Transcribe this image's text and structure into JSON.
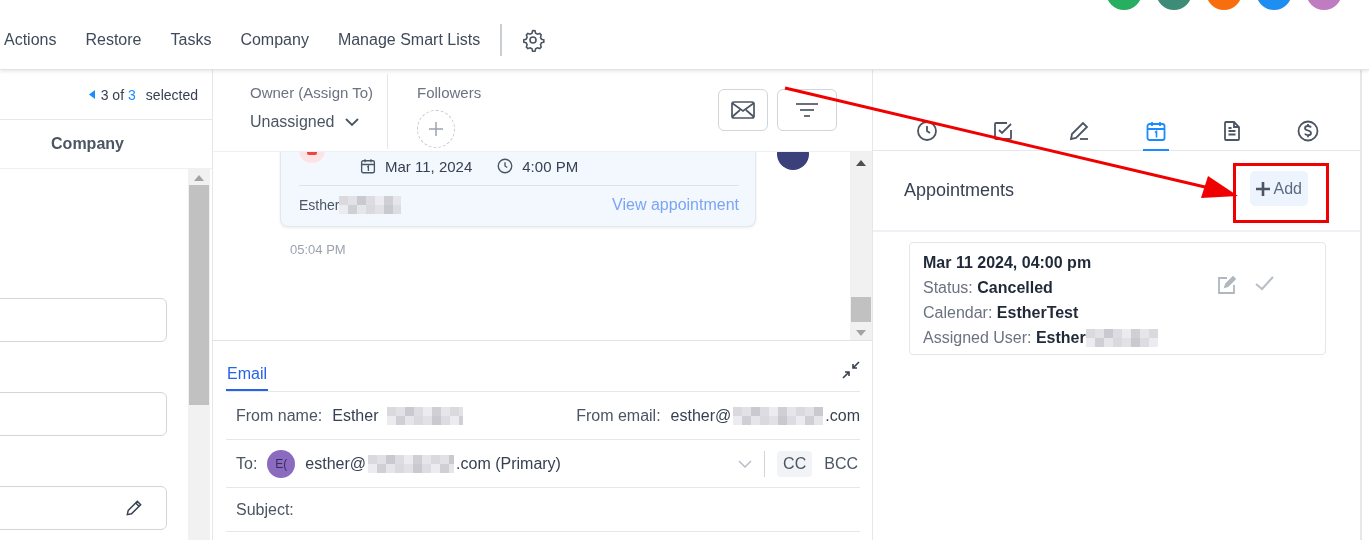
{
  "nav": {
    "items": [
      "Actions",
      "Restore",
      "Tasks",
      "Company",
      "Manage Smart Lists"
    ]
  },
  "avatars": [
    {
      "color": "#27ae60"
    },
    {
      "color": "#3d8c78"
    },
    {
      "color": "#f86d0d"
    },
    {
      "color": "#1f8ef1"
    },
    {
      "color": "#c07cc0"
    }
  ],
  "selection": {
    "prefix": "3 of",
    "count": "3",
    "suffix": "selected"
  },
  "contact_list": {
    "column": "Company",
    "fields": [
      {
        "kind": "text"
      },
      {
        "kind": "text"
      },
      {
        "kind": "editable"
      }
    ]
  },
  "owner": {
    "label": "Owner (Assign To)",
    "value": "Unassigned"
  },
  "followers": {
    "label": "Followers"
  },
  "appointment_message": {
    "date": "Mar 11, 2024",
    "time": "4:00 PM",
    "author": "Esther",
    "link": "View appointment",
    "timestamp": "05:04 PM"
  },
  "compose": {
    "tabs": [
      {
        "label": "Email",
        "selected": true
      }
    ],
    "from_name_label": "From name:",
    "from_name": "Esther",
    "from_email_label": "From email:",
    "from_email_user": "esther@",
    "from_email_domain": ".com",
    "to_label": "To:",
    "to_avatar": "E(",
    "to_user": "esther@",
    "to_domain": ".com (Primary)",
    "cc": "CC",
    "bcc": "BCC",
    "subject_label": "Subject:"
  },
  "side_tabs": [
    {
      "kind": "history",
      "selected": false
    },
    {
      "kind": "task",
      "selected": false
    },
    {
      "kind": "note",
      "selected": false
    },
    {
      "kind": "calendar",
      "selected": true
    },
    {
      "kind": "document",
      "selected": false
    },
    {
      "kind": "payment",
      "selected": false
    }
  ],
  "appointments": {
    "title": "Appointments",
    "add": "Add",
    "items": [
      {
        "datetime": "Mar 11 2024, 04:00 pm",
        "status_label": "Status:",
        "status": "Cancelled",
        "calendar_label": "Calendar:",
        "calendar": "EstherTest",
        "user_label": "Assigned User:",
        "user": "Esther"
      }
    ]
  }
}
